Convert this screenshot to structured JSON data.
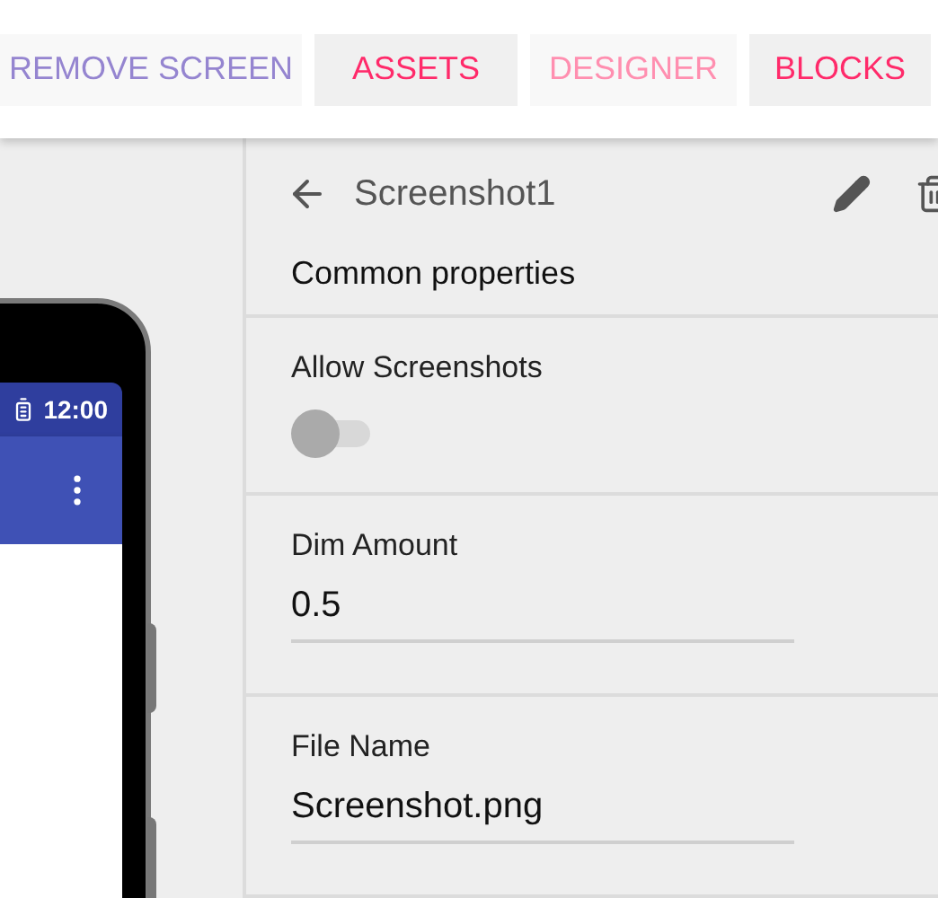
{
  "top_buttons": [
    {
      "label": "REMOVE SCREEN",
      "kind": "secondary",
      "disabled": false
    },
    {
      "label": "ASSETS",
      "kind": "primary",
      "disabled": false
    },
    {
      "label": "DESIGNER",
      "kind": "primary",
      "disabled": true
    },
    {
      "label": "BLOCKS",
      "kind": "primary",
      "disabled": false
    }
  ],
  "phone": {
    "status_time": "12:00"
  },
  "panel": {
    "title": "Screenshot1",
    "section": "Common properties",
    "properties": [
      {
        "kind": "switch",
        "label": "Allow Screenshots",
        "on": false
      },
      {
        "kind": "text",
        "label": "Dim Amount",
        "value": "0.5"
      },
      {
        "kind": "text",
        "label": "File Name",
        "value": "Screenshot.png"
      }
    ]
  }
}
